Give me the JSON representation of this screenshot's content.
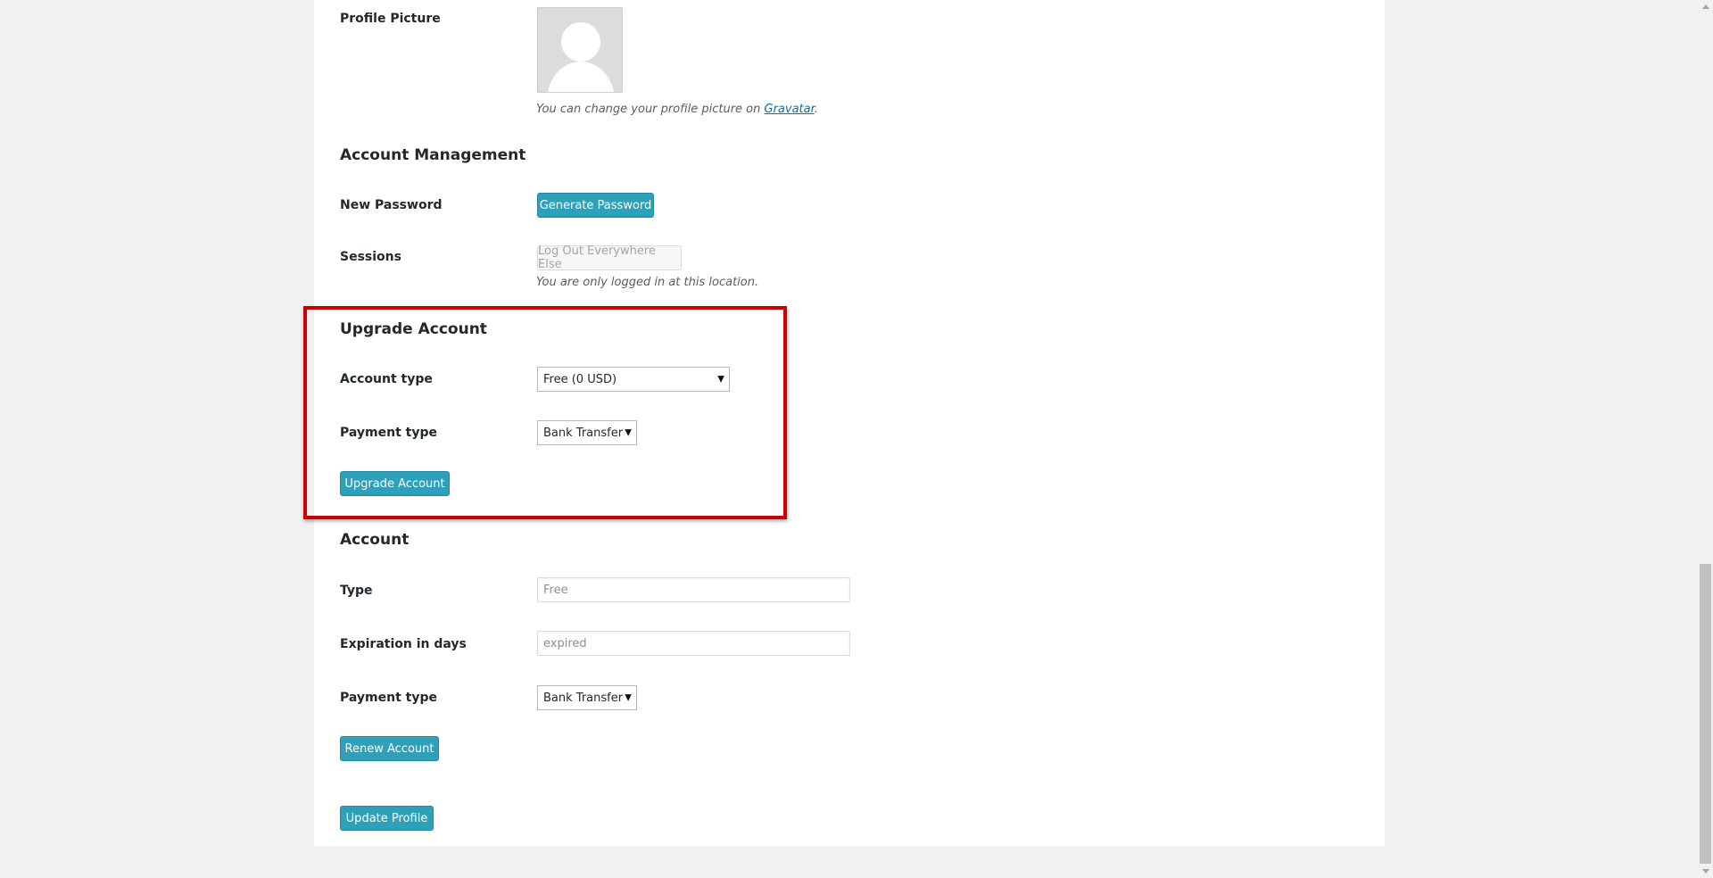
{
  "profile_picture": {
    "label": "Profile Picture",
    "description_prefix": "You can change your profile picture on ",
    "link_text": "Gravatar",
    "description_suffix": "."
  },
  "account_management": {
    "title": "Account Management",
    "new_password_label": "New Password",
    "generate_password_button": "Generate Password",
    "sessions_label": "Sessions",
    "logout_button": "Log Out Everywhere Else",
    "sessions_note": "You are only logged in at this location."
  },
  "upgrade_account": {
    "title": "Upgrade Account",
    "account_type_label": "Account type",
    "account_type_value": "Free (0 USD)",
    "payment_type_label": "Payment type",
    "payment_type_value": "Bank Transfer",
    "upgrade_button": "Upgrade Account"
  },
  "account": {
    "title": "Account",
    "type_label": "Type",
    "type_value": "Free",
    "expiration_label": "Expiration in days",
    "expiration_value": "expired",
    "payment_type_label": "Payment type",
    "payment_type_value": "Bank Transfer",
    "renew_button": "Renew Account"
  },
  "update_profile_button": "Update Profile",
  "colors": {
    "primary_button": "#2fa0b9",
    "highlight_border": "#cc0000",
    "page_background": "#f1f1f1",
    "panel_background": "#ffffff"
  },
  "icons": {
    "avatar": "default-user-avatar-icon",
    "select_arrow": "dropdown-arrow-icon"
  }
}
